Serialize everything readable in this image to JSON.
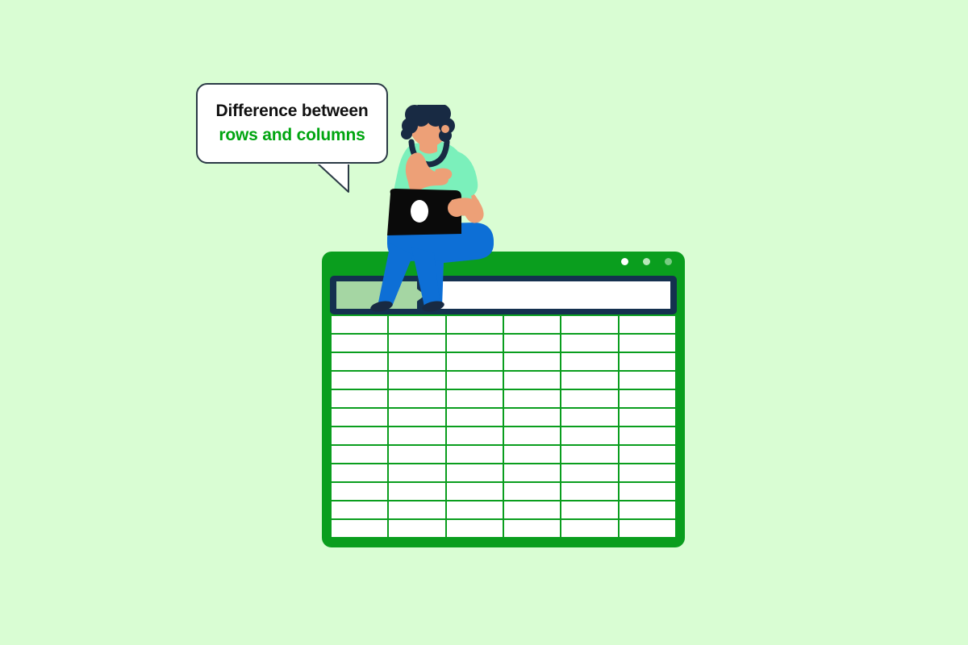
{
  "page": {
    "background_color": "#d9fdd3",
    "title": "Difference between rows and columns"
  },
  "speech_bubble": {
    "name": "speech-bubble",
    "line1": "Difference between",
    "line2": "rows and columns",
    "line1_color": "#111111",
    "line2_color": "#00a510",
    "background_color": "#ffffff",
    "border_color": "#2b3a46"
  },
  "spreadsheet": {
    "frame_color": "#0a9e1e",
    "titlebar": {
      "name": "window-titlebar",
      "dots": [
        {
          "name": "window-dot-close",
          "color": "#ffffff"
        },
        {
          "name": "window-dot-minimize",
          "color": "#b7e8b9"
        },
        {
          "name": "window-dot-maximize",
          "color": "#79cc83"
        }
      ]
    },
    "formula_bar": {
      "name": "formula-bar",
      "background_color": "#14304f",
      "name_box": {
        "name": "name-box",
        "value": "",
        "color": "#a5d6a3"
      },
      "input": {
        "name": "formula-input",
        "value": "",
        "placeholder": ""
      }
    },
    "grid": {
      "name": "spreadsheet-grid",
      "columns": 6,
      "rows": 12,
      "cell_background": "#ffffff",
      "gridline_color": "#0a9e1e",
      "cells": [
        [
          "",
          "",
          "",
          "",
          "",
          ""
        ],
        [
          "",
          "",
          "",
          "",
          "",
          ""
        ],
        [
          "",
          "",
          "",
          "",
          "",
          ""
        ],
        [
          "",
          "",
          "",
          "",
          "",
          ""
        ],
        [
          "",
          "",
          "",
          "",
          "",
          ""
        ],
        [
          "",
          "",
          "",
          "",
          "",
          ""
        ],
        [
          "",
          "",
          "",
          "",
          "",
          ""
        ],
        [
          "",
          "",
          "",
          "",
          "",
          ""
        ],
        [
          "",
          "",
          "",
          "",
          "",
          ""
        ],
        [
          "",
          "",
          "",
          "",
          "",
          ""
        ],
        [
          "",
          "",
          "",
          "",
          "",
          ""
        ],
        [
          "",
          "",
          "",
          "",
          "",
          ""
        ]
      ]
    }
  },
  "character": {
    "name": "person-with-laptop-illustration",
    "hair_color": "#182a43",
    "skin_color": "#eda077",
    "shirt_color": "#7bf0bb",
    "pants_color": "#0d6fd6",
    "laptop_color": "#0a0a0a",
    "shoe_color": "#182a43"
  }
}
